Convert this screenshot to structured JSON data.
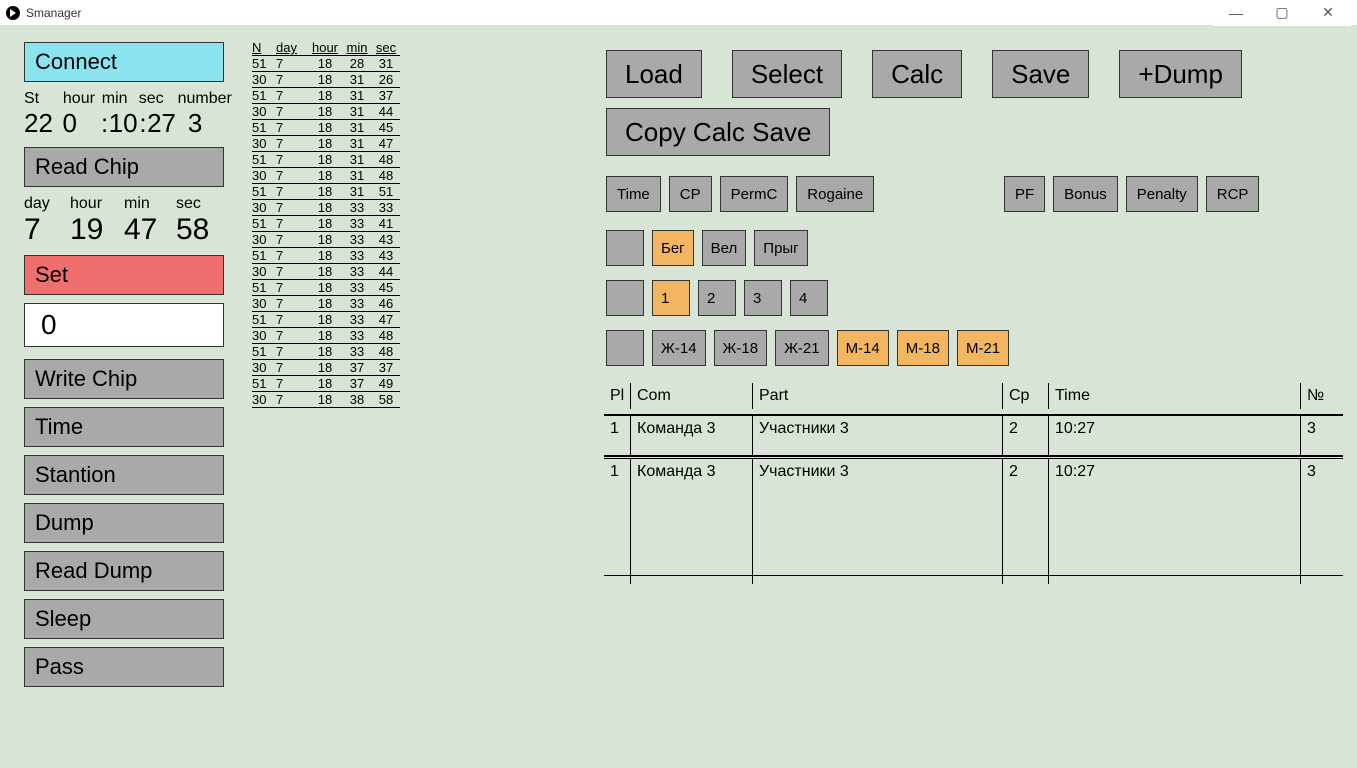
{
  "window": {
    "title": "Smanager"
  },
  "left": {
    "connect": "Connect",
    "read_chip": "Read Chip",
    "set": "Set",
    "input_value": "0",
    "write_chip": "Write Chip",
    "time": "Time",
    "stantion": "Stantion",
    "dump": "Dump",
    "read_dump": "Read Dump",
    "sleep": "Sleep",
    "pass": "Pass",
    "labels": {
      "st": "St",
      "hour": "hour",
      "min": "min",
      "sec": "sec",
      "number": "number",
      "day": "day"
    },
    "status": {
      "st": "22",
      "hour": "0",
      "colon": ":",
      "min": "10",
      "sec": "27",
      "number": "3"
    },
    "clock": {
      "day": "7",
      "hour": "19",
      "min": "47",
      "sec": "58"
    }
  },
  "log": {
    "headers": {
      "n": "N",
      "day": "day",
      "hour": "hour",
      "min": "min",
      "sec": "sec"
    },
    "rows": [
      {
        "n": "51",
        "day": "7",
        "hour": "18",
        "min": "28",
        "sec": "31"
      },
      {
        "n": "30",
        "day": "7",
        "hour": "18",
        "min": "31",
        "sec": "26"
      },
      {
        "n": "51",
        "day": "7",
        "hour": "18",
        "min": "31",
        "sec": "37"
      },
      {
        "n": "30",
        "day": "7",
        "hour": "18",
        "min": "31",
        "sec": "44"
      },
      {
        "n": "51",
        "day": "7",
        "hour": "18",
        "min": "31",
        "sec": "45"
      },
      {
        "n": "30",
        "day": "7",
        "hour": "18",
        "min": "31",
        "sec": "47"
      },
      {
        "n": "51",
        "day": "7",
        "hour": "18",
        "min": "31",
        "sec": "48"
      },
      {
        "n": "30",
        "day": "7",
        "hour": "18",
        "min": "31",
        "sec": "48"
      },
      {
        "n": "51",
        "day": "7",
        "hour": "18",
        "min": "31",
        "sec": "51"
      },
      {
        "n": "30",
        "day": "7",
        "hour": "18",
        "min": "33",
        "sec": "33"
      },
      {
        "n": "51",
        "day": "7",
        "hour": "18",
        "min": "33",
        "sec": "41"
      },
      {
        "n": "30",
        "day": "7",
        "hour": "18",
        "min": "33",
        "sec": "43"
      },
      {
        "n": "51",
        "day": "7",
        "hour": "18",
        "min": "33",
        "sec": "43"
      },
      {
        "n": "30",
        "day": "7",
        "hour": "18",
        "min": "33",
        "sec": "44"
      },
      {
        "n": "51",
        "day": "7",
        "hour": "18",
        "min": "33",
        "sec": "45"
      },
      {
        "n": "30",
        "day": "7",
        "hour": "18",
        "min": "33",
        "sec": "46"
      },
      {
        "n": "51",
        "day": "7",
        "hour": "18",
        "min": "33",
        "sec": "47"
      },
      {
        "n": "30",
        "day": "7",
        "hour": "18",
        "min": "33",
        "sec": "48"
      },
      {
        "n": "51",
        "day": "7",
        "hour": "18",
        "min": "33",
        "sec": "48"
      },
      {
        "n": "30",
        "day": "7",
        "hour": "18",
        "min": "37",
        "sec": "37"
      },
      {
        "n": "51",
        "day": "7",
        "hour": "18",
        "min": "37",
        "sec": "49"
      },
      {
        "n": "30",
        "day": "7",
        "hour": "18",
        "min": "38",
        "sec": "58"
      }
    ]
  },
  "top": {
    "load": "Load",
    "select": "Select",
    "calc": "Calc",
    "save": "Save",
    "plus_dump": "+Dump",
    "copy_calc_save": "Copy Calc Save"
  },
  "fil1": {
    "time": "Time",
    "cp": "CP",
    "permc": "PermC",
    "rogaine": "Rogaine"
  },
  "fil1r": {
    "pf": "PF",
    "bonus": "Bonus",
    "penalty": "Penalty",
    "rcp": "RCP"
  },
  "fil2": {
    "beg": "Бег",
    "vel": "Вел",
    "pryg": "Прыг"
  },
  "fil3": {
    "one": "1",
    "two": "2",
    "three": "3",
    "four": "4"
  },
  "fil4": {
    "z14": "Ж-14",
    "z18": "Ж-18",
    "z21": "Ж-21",
    "m14": "М-14",
    "m18": "М-18",
    "m21": "М-21"
  },
  "result": {
    "headers": {
      "pl": "Pl",
      "com": "Com",
      "part": "Part",
      "cp": "Cp",
      "time": "Time",
      "no": "№"
    },
    "rows": [
      {
        "pl": "1",
        "com": "Команда 3",
        "part": "Участники 3",
        "cp": "2",
        "time": "10:27",
        "no": "3"
      },
      {
        "pl": "1",
        "com": "Команда 3",
        "part": "Участники 3",
        "cp": "2",
        "time": "10:27",
        "no": "3"
      }
    ]
  }
}
